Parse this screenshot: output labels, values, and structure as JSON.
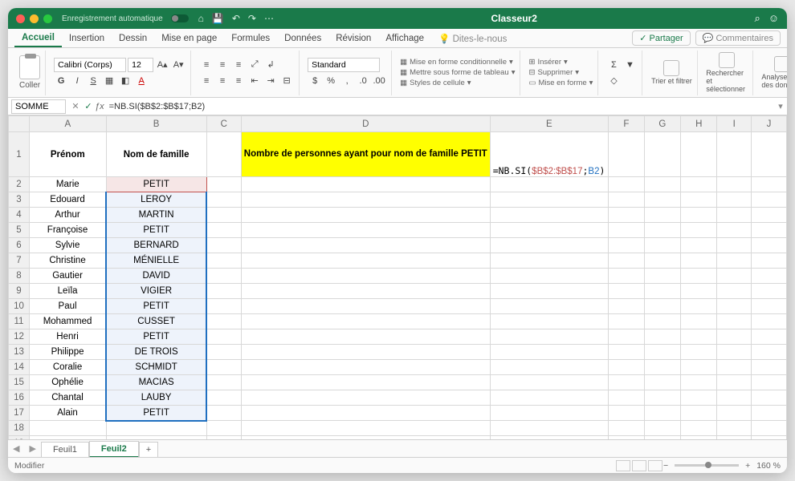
{
  "titlebar": {
    "autosave": "Enregistrement automatique",
    "filename": "Classeur2"
  },
  "tabs": {
    "items": [
      "Accueil",
      "Insertion",
      "Dessin",
      "Mise en page",
      "Formules",
      "Données",
      "Révision",
      "Affichage"
    ],
    "tell_me": "Dites-le-nous",
    "share": "Partager",
    "comments": "Commentaires"
  },
  "ribbon": {
    "paste": "Coller",
    "font_name": "Calibri (Corps)",
    "font_size": "12",
    "number_format": "Standard",
    "cond_fmt": "Mise en forme conditionnelle",
    "table_fmt": "Mettre sous forme de tableau",
    "cell_styles": "Styles de cellule",
    "insert": "Insérer",
    "delete": "Supprimer",
    "format": "Mise en forme",
    "sort_filter": "Trier et filtrer",
    "find_select": "Rechercher et sélectionner",
    "analyze": "Analyser des données"
  },
  "formula_bar": {
    "name_box": "SOMME",
    "formula": "=NB.SI($B$2:$B$17;B2)"
  },
  "headers": {
    "A": "Prénom",
    "B": "Nom de famille"
  },
  "yellow_label": "Nombre de personnes ayant pour nom de famille PETIT",
  "e1_formula": {
    "prefix": "=NB.SI(",
    "abs": "$B$2:$B$17",
    "sep": ";",
    "rel": "B2",
    "suffix": ")"
  },
  "rows": [
    {
      "a": "Marie",
      "b": "PETIT"
    },
    {
      "a": "Edouard",
      "b": "LEROY"
    },
    {
      "a": "Arthur",
      "b": "MARTIN"
    },
    {
      "a": "Françoise",
      "b": "PETIT"
    },
    {
      "a": "Sylvie",
      "b": "BERNARD"
    },
    {
      "a": "Christine",
      "b": "MÉNIELLE"
    },
    {
      "a": "Gautier",
      "b": "DAVID"
    },
    {
      "a": "Leïla",
      "b": "VIGIER"
    },
    {
      "a": "Paul",
      "b": "PETIT"
    },
    {
      "a": "Mohammed",
      "b": "CUSSET"
    },
    {
      "a": "Henri",
      "b": "PETIT"
    },
    {
      "a": "Philippe",
      "b": "DE TROIS"
    },
    {
      "a": "Coralie",
      "b": "SCHMIDT"
    },
    {
      "a": "Ophélie",
      "b": "MACIAS"
    },
    {
      "a": "Chantal",
      "b": "LAUBY"
    },
    {
      "a": "Alain",
      "b": "PETIT"
    }
  ],
  "cols": [
    "A",
    "B",
    "C",
    "D",
    "E",
    "F",
    "G",
    "H",
    "I",
    "J"
  ],
  "sheets": {
    "s1": "Feuil1",
    "s2": "Feuil2"
  },
  "status": {
    "mode": "Modifier",
    "zoom": "160 %"
  }
}
